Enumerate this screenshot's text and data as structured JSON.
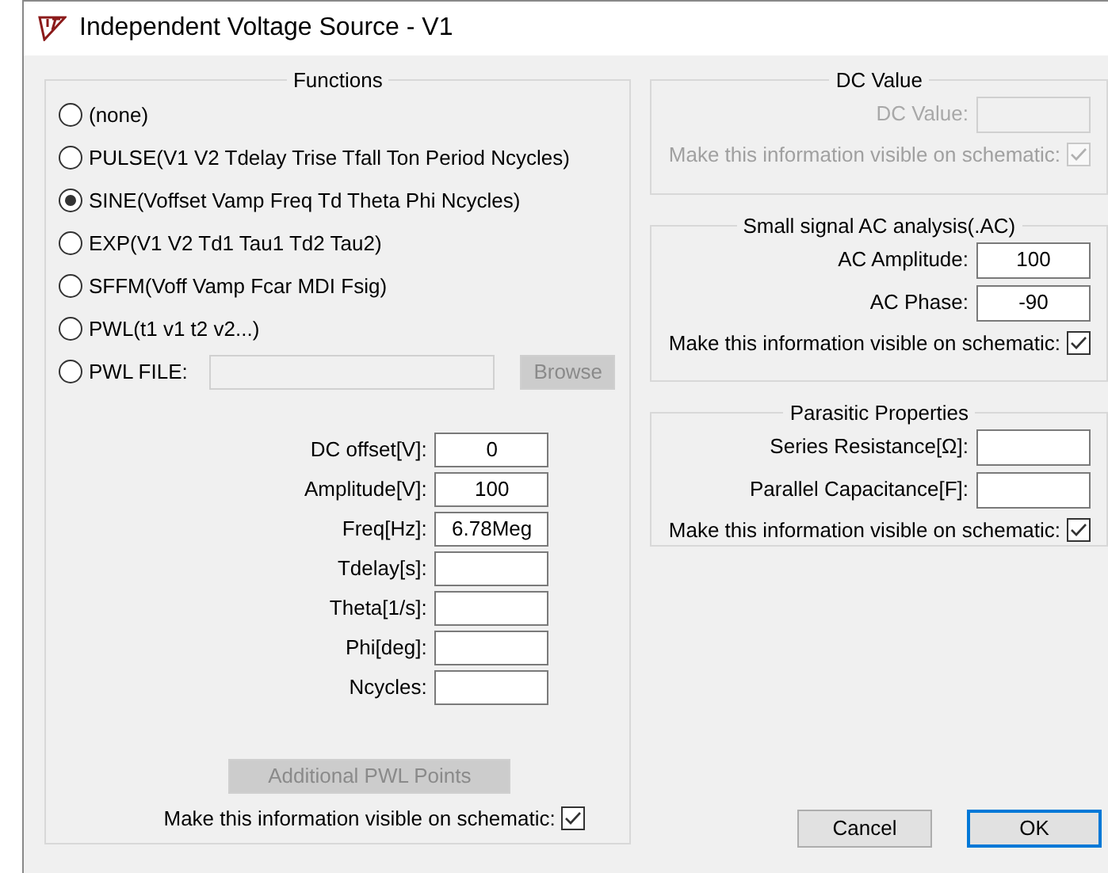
{
  "window": {
    "title": "Independent Voltage Source - V1"
  },
  "functions": {
    "title": "Functions",
    "options": [
      {
        "label": "(none)",
        "selected": false
      },
      {
        "label": "PULSE(V1 V2 Tdelay Trise Tfall Ton Period Ncycles)",
        "selected": false
      },
      {
        "label": "SINE(Voffset Vamp Freq Td Theta Phi Ncycles)",
        "selected": true
      },
      {
        "label": "EXP(V1 V2 Td1 Tau1 Td2 Tau2)",
        "selected": false
      },
      {
        "label": "SFFM(Voff Vamp Fcar MDI Fsig)",
        "selected": false
      },
      {
        "label": "PWL(t1 v1 t2 v2...)",
        "selected": false
      },
      {
        "label": "PWL FILE:",
        "selected": false
      }
    ],
    "browse_button": {
      "label": "Browse",
      "disabled": true
    },
    "parameters": [
      {
        "label": "DC offset[V]:",
        "value": "0"
      },
      {
        "label": "Amplitude[V]:",
        "value": "100"
      },
      {
        "label": "Freq[Hz]:",
        "value": "6.78Meg"
      },
      {
        "label": "Tdelay[s]:"
      },
      {
        "label": "Theta[1/s]:"
      },
      {
        "label": "Phi[deg]:"
      },
      {
        "label": "Ncycles:"
      }
    ],
    "additional_button": {
      "label": "Additional PWL Points",
      "disabled": true
    },
    "visible": {
      "label": "Make this information visible on schematic:",
      "checked": true
    }
  },
  "dc_value": {
    "title": "DC Value",
    "disabled": true,
    "fields": [
      {
        "label": "DC Value:"
      }
    ],
    "visible": {
      "label": "Make this information visible on schematic:",
      "checked": true
    }
  },
  "ac_analysis": {
    "title": "Small signal AC analysis(.AC)",
    "disabled": false,
    "fields": [
      {
        "label": "AC Amplitude:",
        "value": "100"
      },
      {
        "label": "AC Phase:",
        "value": "-90"
      }
    ],
    "visible": {
      "label": "Make this information visible on schematic:",
      "checked": true
    }
  },
  "parasitic": {
    "title": "Parasitic Properties",
    "disabled": false,
    "fields": [
      {
        "label": "Series Resistance[Ω]:"
      },
      {
        "label": "Parallel Capacitance[F]:"
      }
    ],
    "visible": {
      "label": "Make this information visible on schematic:",
      "checked": true
    }
  },
  "buttons": [
    {
      "label": "Cancel",
      "default": false
    },
    {
      "label": "OK",
      "default": true
    }
  ]
}
